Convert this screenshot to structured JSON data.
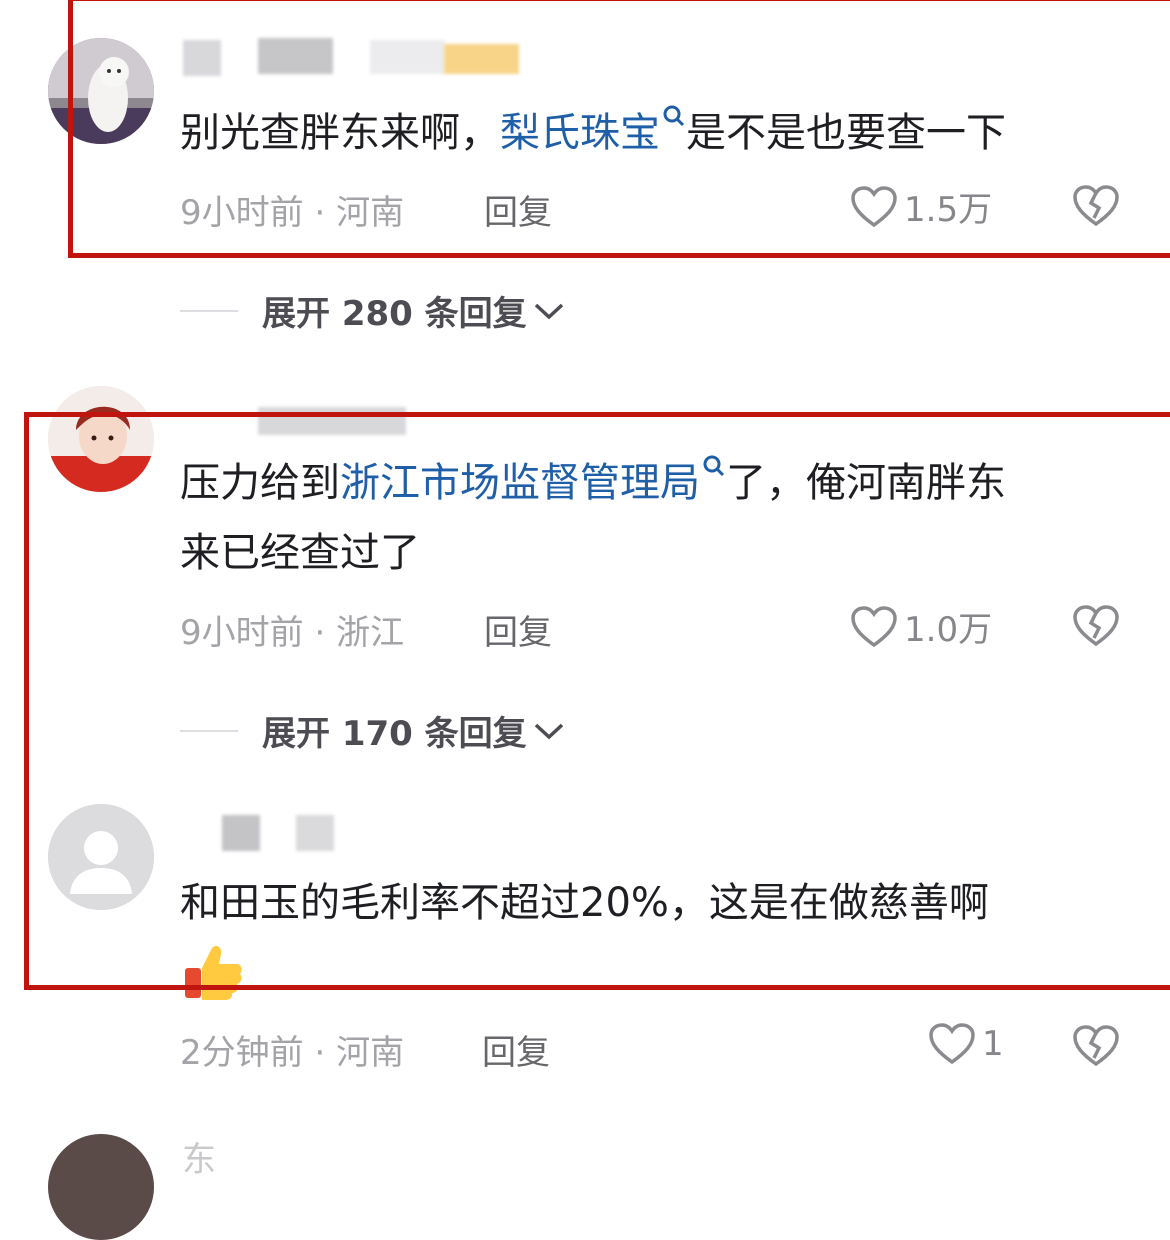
{
  "colors": {
    "highlight_frame": "#c0140f",
    "link": "#1f5fa8",
    "meta": "#a3a3a8",
    "text": "#1e1e23"
  },
  "comments": [
    {
      "avatar": "white-cat-photo",
      "text_pre": "别光查胖东来啊，",
      "link": "梨氏珠宝",
      "text_post": "是不是也要查一下",
      "time": "9小时前",
      "location": "河南",
      "reply_label": "回复",
      "likes": "1.5万",
      "expand": "展开 280 条回复"
    },
    {
      "avatar": "anime-boy-red-hair",
      "text_pre": "压力给到",
      "link": "浙江市场监督管理局",
      "text_post": "了，俺河南胖东",
      "text_line2": "来已经查过了",
      "time": "9小时前",
      "location": "浙江",
      "reply_label": "回复",
      "likes": "1.0万",
      "expand": "展开 170 条回复"
    },
    {
      "avatar": "default-user-silhouette",
      "text": "和田玉的毛利率不超过20%，这是在做慈善啊",
      "emoji": "thumbs-up",
      "time": "2分钟前",
      "location": "河南",
      "reply_label": "回复",
      "likes": "1"
    },
    {
      "avatar": "partial-avatar",
      "username": "东"
    }
  ],
  "separator": "·",
  "icons": {
    "like": "heart-outline-icon",
    "dislike": "broken-heart-icon",
    "expand": "chevron-down-icon",
    "search": "search-mark-icon"
  }
}
